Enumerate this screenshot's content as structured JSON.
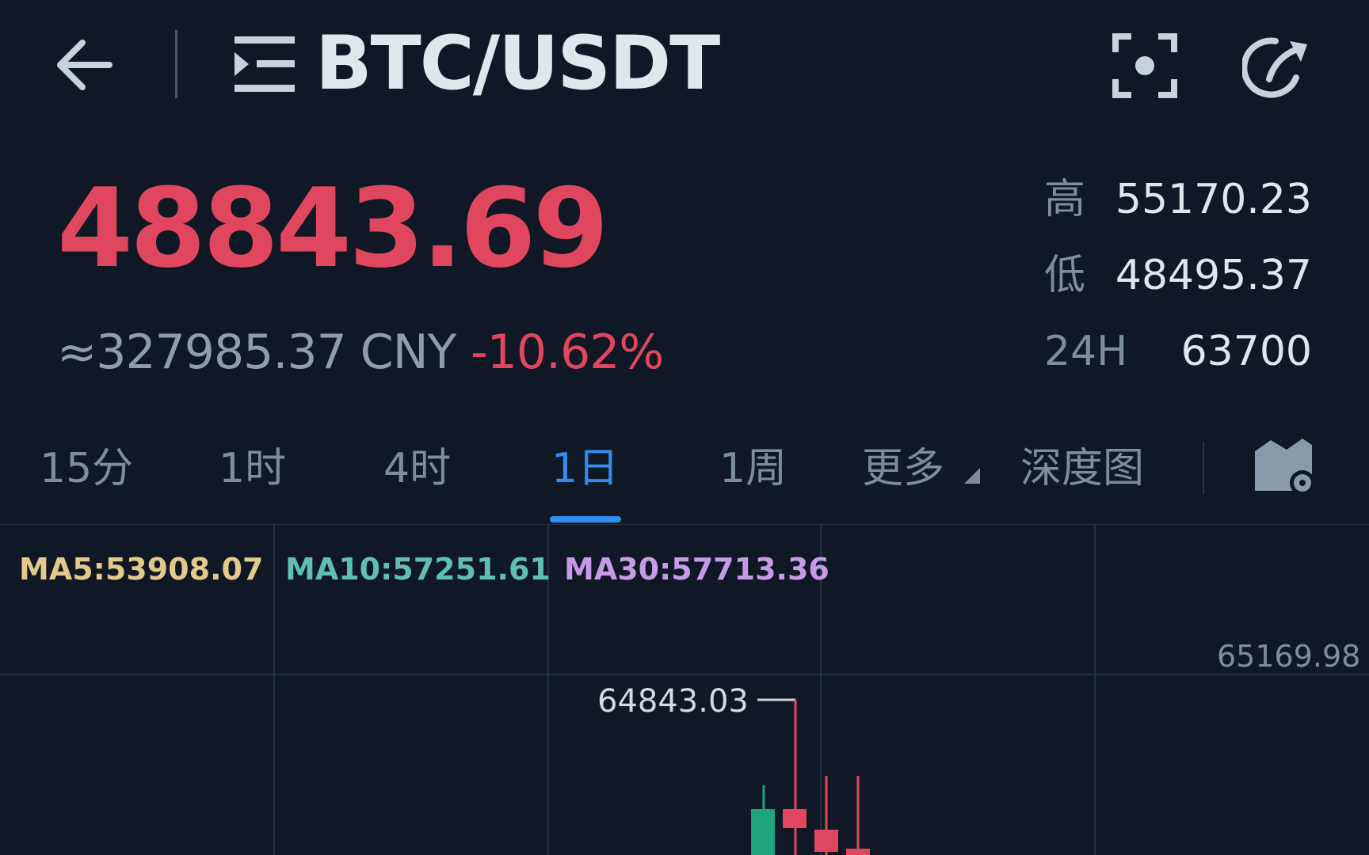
{
  "header": {
    "pair": "BTC/USDT"
  },
  "price": {
    "last": "48843.69",
    "cny": "≈327985.37 CNY",
    "change_pct": "-10.62%"
  },
  "stats": [
    {
      "label": "高",
      "value": "55170.23"
    },
    {
      "label": "低",
      "value": "48495.37"
    },
    {
      "label": "24H",
      "value": "63700"
    }
  ],
  "tabs": [
    "15分",
    "1时",
    "4时",
    "1日",
    "1周",
    "更多",
    "深度图"
  ],
  "active_tab": "1日",
  "chart": {
    "ma5": "MA5:53908.07",
    "ma10": "MA10:57251.61",
    "ma30": "MA30:57713.36",
    "axis_top": "65169.98",
    "max_marker": "64843.03"
  },
  "chart_data": {
    "type": "candlestick",
    "series": [
      {
        "name": "MA5",
        "value": 53908.07
      },
      {
        "name": "MA10",
        "value": 57251.61
      },
      {
        "name": "MA30",
        "value": 57713.36
      }
    ],
    "visible_high_axis": 65169.98,
    "max_price_marker": 64843.03,
    "candles": [
      {
        "direction": "up"
      },
      {
        "direction": "down"
      },
      {
        "direction": "down"
      },
      {
        "direction": "down"
      }
    ],
    "colors": {
      "up": "#1ea37d",
      "down": "#e0475e"
    },
    "grid": true
  },
  "colors": {
    "background": "#0f1824",
    "accent": "#2f8ef0",
    "negative": "#e0475e",
    "positive": "#1ea37d"
  }
}
